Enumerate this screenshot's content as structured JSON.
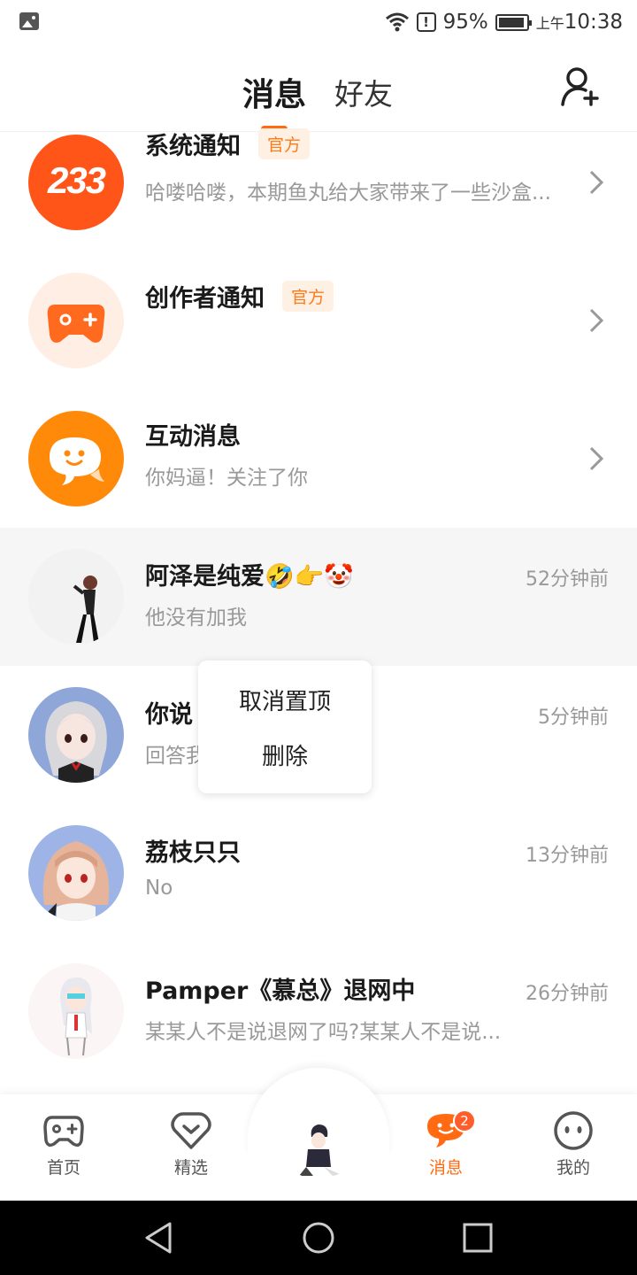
{
  "status_bar": {
    "battery": "95%",
    "time_prefix": "上午",
    "time": "10:38",
    "icons": [
      "image-icon",
      "wifi-icon",
      "alert-icon",
      "battery-icon"
    ]
  },
  "header": {
    "tabs": [
      {
        "label": "消息",
        "active": true
      },
      {
        "label": "好友",
        "active": false
      }
    ],
    "add_friend_icon": "add-friend-icon",
    "accent_color": "#ff6a13"
  },
  "official_badge": "官方",
  "notifications": [
    {
      "title": "系统通知",
      "official": true,
      "preview": "哈喽哈喽，本期鱼丸给大家带来了一些沙盒...",
      "avatar_text": "233",
      "avatar_color": "#ff5518"
    },
    {
      "title": "创作者通知",
      "official": true,
      "preview": "",
      "avatar_icon": "gamepad-icon",
      "avatar_color": "#ff6a1f"
    },
    {
      "title": "互动消息",
      "official": false,
      "preview": "你妈逼！关注了你",
      "avatar_icon": "chat-bubble-icon",
      "avatar_color": "#ff8a0a"
    }
  ],
  "chats": [
    {
      "name": "阿泽是纯爱🤣👉🤡",
      "preview": "他没有加我",
      "time": "52分钟前",
      "pinned": true
    },
    {
      "name": "你说",
      "name_tail": "?",
      "preview": "回答我",
      "time": "5分钟前",
      "pinned": false
    },
    {
      "name": "荔枝只只",
      "preview": "No",
      "time": "13分钟前",
      "pinned": false
    },
    {
      "name": "Pamper《慕总》退网中",
      "preview": "某某人不是说退网了吗?某某人不是说...",
      "time": "26分钟前",
      "pinned": false
    }
  ],
  "context_menu": {
    "items": [
      "取消置顶",
      "删除"
    ]
  },
  "bottom_nav": {
    "items": [
      {
        "label": "首页",
        "icon": "gamepad-icon",
        "active": false
      },
      {
        "label": "精选",
        "icon": "heart-chevron-icon",
        "active": false
      },
      {
        "label": "消息",
        "icon": "chat-bubble-icon",
        "active": true,
        "badge": "2"
      },
      {
        "label": "我的",
        "icon": "face-icon",
        "active": false
      }
    ]
  },
  "system_nav": [
    "back-icon",
    "home-icon",
    "recents-icon"
  ]
}
